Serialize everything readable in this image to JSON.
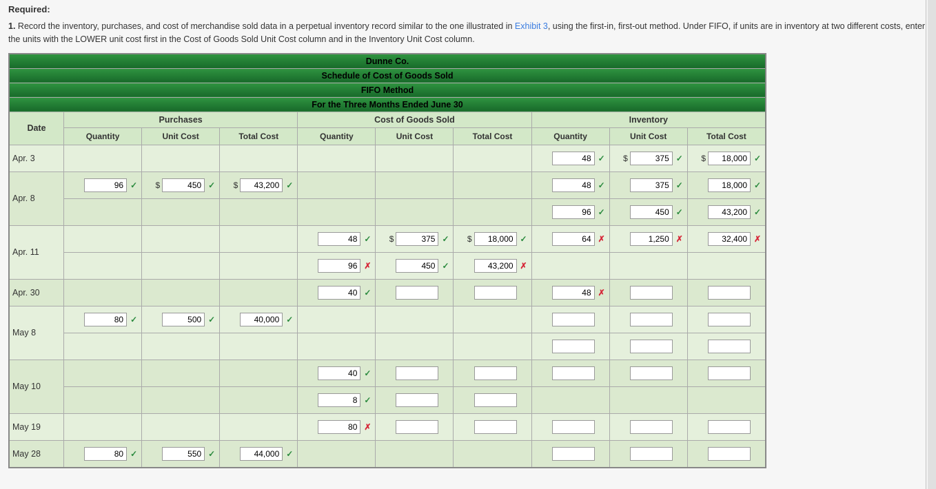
{
  "heading": "Required:",
  "instruction_parts": {
    "num": "1.",
    "text1": "  Record the inventory, purchases, and cost of merchandise sold data in a perpetual inventory record similar to the one illustrated in ",
    "link": "Exhibit 3",
    "text2": ", using the first-in, first-out method. Under FIFO, if units are in inventory at two different costs, enter the units with the LOWER unit cost first in the Cost of Goods Sold Unit Cost column and in the Inventory Unit Cost column."
  },
  "title_lines": [
    "Dunne Co.",
    "Schedule of Cost of Goods Sold",
    "FIFO Method",
    "For the Three Months Ended June 30"
  ],
  "group_headers": {
    "date": "Date",
    "purchases": "Purchases",
    "cogs": "Cost of Goods Sold",
    "inventory": "Inventory"
  },
  "col_headers": {
    "qty": "Quantity",
    "unit": "Unit Cost",
    "total": "Total Cost"
  },
  "rows": [
    {
      "date": "Apr. 3",
      "sub": [
        {
          "p": [
            null,
            null,
            null
          ],
          "c": [
            null,
            null,
            null
          ],
          "i": [
            {
              "v": "48",
              "m": "ok",
              "cur": ""
            },
            {
              "v": "375",
              "m": "ok",
              "cur": "$"
            },
            {
              "v": "18,000",
              "m": "ok",
              "cur": "$"
            }
          ]
        }
      ]
    },
    {
      "date": "Apr. 8",
      "sub": [
        {
          "p": [
            {
              "v": "96",
              "m": "ok",
              "cur": ""
            },
            {
              "v": "450",
              "m": "ok",
              "cur": "$"
            },
            {
              "v": "43,200",
              "m": "ok",
              "cur": "$"
            }
          ],
          "c": [
            null,
            null,
            null
          ],
          "i": [
            {
              "v": "48",
              "m": "ok",
              "cur": ""
            },
            {
              "v": "375",
              "m": "ok",
              "cur": ""
            },
            {
              "v": "18,000",
              "m": "ok",
              "cur": ""
            }
          ]
        },
        {
          "p": [
            null,
            null,
            null
          ],
          "c": [
            null,
            null,
            null
          ],
          "i": [
            {
              "v": "96",
              "m": "ok",
              "cur": ""
            },
            {
              "v": "450",
              "m": "ok",
              "cur": ""
            },
            {
              "v": "43,200",
              "m": "ok",
              "cur": ""
            }
          ]
        }
      ]
    },
    {
      "date": "Apr. 11",
      "sub": [
        {
          "p": [
            null,
            null,
            null
          ],
          "c": [
            {
              "v": "48",
              "m": "ok",
              "cur": ""
            },
            {
              "v": "375",
              "m": "ok",
              "cur": "$"
            },
            {
              "v": "18,000",
              "m": "ok",
              "cur": "$"
            }
          ],
          "i": [
            {
              "v": "64",
              "m": "bad",
              "cur": ""
            },
            {
              "v": "1,250",
              "m": "bad",
              "cur": ""
            },
            {
              "v": "32,400",
              "m": "bad",
              "cur": ""
            }
          ]
        },
        {
          "p": [
            null,
            null,
            null
          ],
          "c": [
            {
              "v": "96",
              "m": "bad",
              "cur": ""
            },
            {
              "v": "450",
              "m": "ok",
              "cur": ""
            },
            {
              "v": "43,200",
              "m": "bad",
              "cur": ""
            }
          ],
          "i": [
            null,
            null,
            null
          ]
        }
      ]
    },
    {
      "date": "Apr. 30",
      "sub": [
        {
          "p": [
            null,
            null,
            null
          ],
          "c": [
            {
              "v": "40",
              "m": "ok",
              "cur": ""
            },
            {
              "v": "",
              "m": "none",
              "cur": ""
            },
            {
              "v": "",
              "m": "none",
              "cur": ""
            }
          ],
          "i": [
            {
              "v": "48",
              "m": "bad",
              "cur": ""
            },
            {
              "v": "",
              "m": "none",
              "cur": ""
            },
            {
              "v": "",
              "m": "none",
              "cur": ""
            }
          ]
        }
      ]
    },
    {
      "date": "May 8",
      "sub": [
        {
          "p": [
            {
              "v": "80",
              "m": "ok",
              "cur": ""
            },
            {
              "v": "500",
              "m": "ok",
              "cur": ""
            },
            {
              "v": "40,000",
              "m": "ok",
              "cur": ""
            }
          ],
          "c": [
            null,
            null,
            null
          ],
          "i": [
            {
              "v": "",
              "m": "none",
              "cur": ""
            },
            {
              "v": "",
              "m": "none",
              "cur": ""
            },
            {
              "v": "",
              "m": "none",
              "cur": ""
            }
          ]
        },
        {
          "p": [
            null,
            null,
            null
          ],
          "c": [
            null,
            null,
            null
          ],
          "i": [
            {
              "v": "",
              "m": "none",
              "cur": ""
            },
            {
              "v": "",
              "m": "none",
              "cur": ""
            },
            {
              "v": "",
              "m": "none",
              "cur": ""
            }
          ]
        }
      ]
    },
    {
      "date": "May 10",
      "sub": [
        {
          "p": [
            null,
            null,
            null
          ],
          "c": [
            {
              "v": "40",
              "m": "ok",
              "cur": ""
            },
            {
              "v": "",
              "m": "none",
              "cur": ""
            },
            {
              "v": "",
              "m": "none",
              "cur": ""
            }
          ],
          "i": [
            {
              "v": "",
              "m": "none",
              "cur": ""
            },
            {
              "v": "",
              "m": "none",
              "cur": ""
            },
            {
              "v": "",
              "m": "none",
              "cur": ""
            }
          ]
        },
        {
          "p": [
            null,
            null,
            null
          ],
          "c": [
            {
              "v": "8",
              "m": "ok",
              "cur": ""
            },
            {
              "v": "",
              "m": "none",
              "cur": ""
            },
            {
              "v": "",
              "m": "none",
              "cur": ""
            }
          ],
          "i": [
            null,
            null,
            null
          ]
        }
      ]
    },
    {
      "date": "May 19",
      "sub": [
        {
          "p": [
            null,
            null,
            null
          ],
          "c": [
            {
              "v": "80",
              "m": "bad",
              "cur": ""
            },
            {
              "v": "",
              "m": "none",
              "cur": ""
            },
            {
              "v": "",
              "m": "none",
              "cur": ""
            }
          ],
          "i": [
            {
              "v": "",
              "m": "none",
              "cur": ""
            },
            {
              "v": "",
              "m": "none",
              "cur": ""
            },
            {
              "v": "",
              "m": "none",
              "cur": ""
            }
          ]
        }
      ]
    },
    {
      "date": "May 28",
      "sub": [
        {
          "p": [
            {
              "v": "80",
              "m": "ok",
              "cur": ""
            },
            {
              "v": "550",
              "m": "ok",
              "cur": ""
            },
            {
              "v": "44,000",
              "m": "ok",
              "cur": ""
            }
          ],
          "c": [
            null,
            null,
            null
          ],
          "i": [
            {
              "v": "",
              "m": "none",
              "cur": ""
            },
            {
              "v": "",
              "m": "none",
              "cur": ""
            },
            {
              "v": "",
              "m": "none",
              "cur": ""
            }
          ]
        }
      ]
    }
  ],
  "glyphs": {
    "ok": "✓",
    "bad": "✗"
  }
}
